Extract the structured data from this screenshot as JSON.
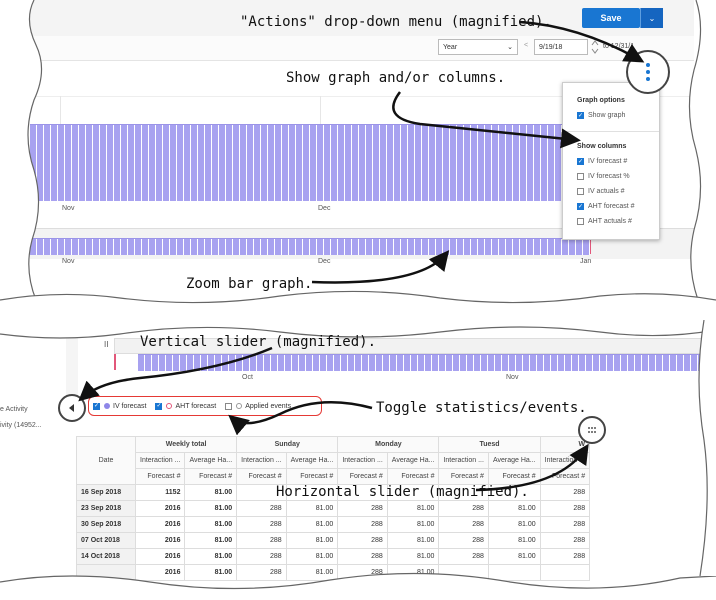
{
  "top": {
    "save_label": "Save",
    "caret": "⌄",
    "period_select": "Year",
    "period_caret": "⌄",
    "prev_arrow": "<",
    "start_date": "9/19/18",
    "to_label": "to 12/31/1",
    "month_labels": [
      "Nov",
      "Dec"
    ],
    "zoom_labels": [
      "Nov",
      "Dec",
      "Jan"
    ]
  },
  "menu": {
    "graph_options_title": "Graph options",
    "show_graph_label": "Show graph",
    "show_graph_checked": true,
    "show_columns_title": "Show columns",
    "columns": [
      {
        "label": "IV forecast #",
        "checked": true
      },
      {
        "label": "IV forecast %",
        "checked": false
      },
      {
        "label": "IV actuals #",
        "checked": false
      },
      {
        "label": "AHT forecast #",
        "checked": true
      },
      {
        "label": "AHT actuals #",
        "checked": false
      }
    ]
  },
  "callouts": {
    "actions_menu": "\"Actions\" drop-down menu (magnified).",
    "show_graph": "Show graph and/or columns.",
    "zoom_bar": "Zoom bar graph.",
    "vertical_slider": "Vertical slider (magnified).",
    "toggle_stats": "Toggle statistics/events.",
    "horizontal_slider": "Horizontal slider (magnified)."
  },
  "bottom": {
    "pause_icon": "II",
    "month_labels": [
      "Oct",
      "Nov"
    ],
    "side_items": [
      "e Activity",
      "ivity (14952..."
    ],
    "toggles": [
      {
        "label": "IV forecast",
        "checked": true,
        "color": "#8e86e8"
      },
      {
        "label": "AHT forecast",
        "checked": true,
        "color": "#e2577a"
      },
      {
        "label": "Applied events",
        "checked": false,
        "color": "#999999"
      }
    ]
  },
  "table": {
    "date_header": "Date",
    "groups": [
      "Weekly total",
      "Sunday",
      "Monday",
      "Tuesd",
      "W"
    ],
    "subheaders": [
      "Interaction ...",
      "Average Ha...",
      "Interaction ...",
      "Average Ha...",
      "Interaction ...",
      "Average Ha...",
      "Interaction ...",
      "Average Ha...",
      "Interaction ..."
    ],
    "forecast_labels": [
      "Forecast #",
      "Forecast #",
      "Forecast #",
      "Forecast #",
      "Forecast #",
      "Forecast #",
      "Forecast #",
      "Forecast #",
      "Forecast #"
    ],
    "rows": [
      {
        "date": "16 Sep 2018",
        "cells": [
          "1152",
          "81.00",
          "",
          "",
          "",
          "",
          "",
          "",
          "288"
        ]
      },
      {
        "date": "23 Sep 2018",
        "cells": [
          "2016",
          "81.00",
          "288",
          "81.00",
          "288",
          "81.00",
          "288",
          "81.00",
          "288"
        ]
      },
      {
        "date": "30 Sep 2018",
        "cells": [
          "2016",
          "81.00",
          "288",
          "81.00",
          "288",
          "81.00",
          "288",
          "81.00",
          "288"
        ]
      },
      {
        "date": "07 Oct 2018",
        "cells": [
          "2016",
          "81.00",
          "288",
          "81.00",
          "288",
          "81.00",
          "288",
          "81.00",
          "288"
        ]
      },
      {
        "date": "14 Oct 2018",
        "cells": [
          "2016",
          "81.00",
          "288",
          "81.00",
          "288",
          "81.00",
          "288",
          "81.00",
          "288"
        ]
      },
      {
        "date": "",
        "cells": [
          "2016",
          "81.00",
          "288",
          "81.00",
          "288",
          "81.00",
          "",
          "",
          ""
        ]
      }
    ]
  }
}
